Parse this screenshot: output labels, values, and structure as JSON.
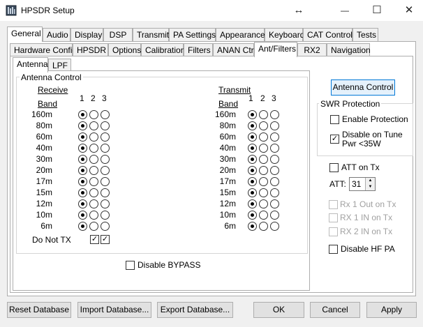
{
  "window": {
    "title": "HPSDR Setup",
    "resize_glyph": "↔",
    "minimize_glyph": "—",
    "maximize_glyph": "☐",
    "close_glyph": "✕"
  },
  "main_tabs": [
    "General",
    "Audio",
    "Display",
    "DSP",
    "Transmit",
    "PA Settings",
    "Appearance",
    "Keyboard",
    "CAT Control",
    "Tests"
  ],
  "sub_tabs": [
    "Hardware Config",
    "HPSDR",
    "Options",
    "Calibration",
    "Filters",
    "ANAN Ctrl",
    "Ant/Filters",
    "RX2",
    "Navigation"
  ],
  "inner_tabs": [
    "Antenna",
    "LPF"
  ],
  "antenna_control": {
    "group_label": "Antenna Control",
    "receive_label": "Receive",
    "transmit_label": "Transmit",
    "band_label": "Band",
    "col_headers": [
      "1",
      "2",
      "3"
    ],
    "bands": [
      "160m",
      "80m",
      "60m",
      "40m",
      "30m",
      "20m",
      "17m",
      "15m",
      "12m",
      "10m",
      "6m"
    ],
    "receive_selected": [
      1,
      1,
      1,
      1,
      1,
      1,
      1,
      1,
      1,
      1,
      1
    ],
    "transmit_selected": [
      1,
      1,
      1,
      1,
      1,
      1,
      1,
      1,
      1,
      1,
      1
    ],
    "do_not_tx_label": "Do Not TX",
    "do_not_tx_checks": [
      true,
      true
    ],
    "checkmark": "✓"
  },
  "disable_bypass": {
    "label": "Disable BYPASS",
    "checked": false
  },
  "antenna_control_button": "Antenna Control",
  "swr": {
    "group_label": "SWR Protection",
    "enable_protection": {
      "label": "Enable Protection",
      "checked": false
    },
    "disable_on_tune": {
      "label_line1": "Disable on Tune",
      "label_line2": "Pwr <35W",
      "checked": true
    }
  },
  "att_on_tx": {
    "label": "ATT on Tx",
    "checked": false
  },
  "att": {
    "label": "ATT:",
    "value": "31",
    "up_glyph": "▲",
    "down_glyph": "▼"
  },
  "rx_options": [
    {
      "label": "Rx 1 Out on Tx",
      "checked": false
    },
    {
      "label": "RX 1 IN on Tx",
      "checked": false
    },
    {
      "label": "RX 2 IN on Tx",
      "checked": false
    }
  ],
  "disable_hf_pa": {
    "label": "Disable HF PA",
    "checked": false
  },
  "bottom_buttons": {
    "reset": "Reset Database",
    "import": "Import Database...",
    "export": "Export Database...",
    "ok": "OK",
    "cancel": "Cancel",
    "apply": "Apply"
  },
  "colors": {
    "focus_border": "#0078d7",
    "focus_fill": "#e5f1fb"
  }
}
